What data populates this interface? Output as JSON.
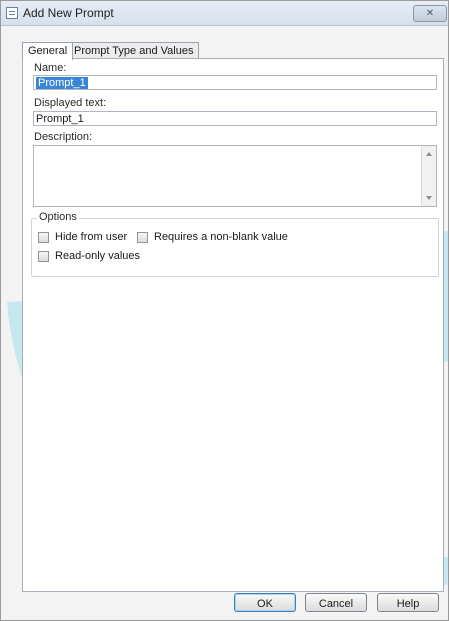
{
  "window": {
    "title": "Add New Prompt",
    "close_icon": "close-icon",
    "app_icon": "list-icon"
  },
  "tabs": [
    {
      "label": "General",
      "active": true
    },
    {
      "label": "Prompt Type and Values",
      "active": false
    }
  ],
  "general": {
    "name_label": "Name:",
    "name_value": "Prompt_1",
    "displayed_text_label": "Displayed text:",
    "displayed_text_value": "Prompt_1",
    "description_label": "Description:",
    "description_value": ""
  },
  "options": {
    "caption": "Options",
    "hide_from_user": {
      "label": "Hide from user",
      "checked": false
    },
    "requires_non_blank": {
      "label": "Requires a non-blank value",
      "checked": false
    },
    "read_only_values": {
      "label": "Read-only values",
      "checked": false
    }
  },
  "buttons": {
    "ok": "OK",
    "cancel": "Cancel",
    "help": "Help"
  },
  "watermark": {
    "text": "DropBo",
    "color": "#6fd4e6"
  }
}
